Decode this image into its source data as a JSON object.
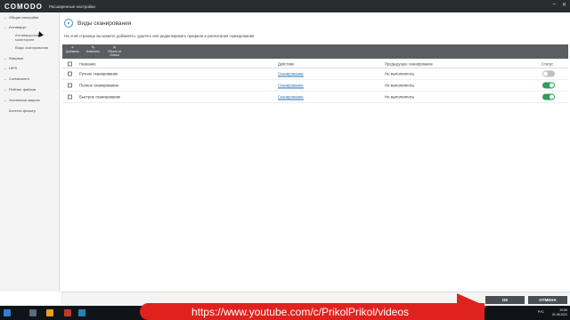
{
  "titlebar": {
    "brand": "COMODO",
    "title": "Расширенные настройки"
  },
  "sidebar": {
    "items": [
      {
        "label": "Общие настройки"
      },
      {
        "label": "Антивирус"
      },
      {
        "label": "Фаервол"
      },
      {
        "label": "HIPS"
      },
      {
        "label": "Containment"
      },
      {
        "label": "Рейтинг файлов"
      },
      {
        "label": "Усиленная защита"
      },
      {
        "label": "Контент-фильтр"
      }
    ],
    "sub": [
      {
        "label": "Антивирусный мониторинг"
      },
      {
        "label": "Виды сканирования"
      }
    ]
  },
  "header": {
    "title": "Виды сканирования",
    "description": "На этой странице вы можете добавлять, удалять или редактировать профили и расписания сканирования"
  },
  "toolbar": {
    "buttons": [
      {
        "label": "Добавить",
        "icon": "plus-icon"
      },
      {
        "label": "Изменить",
        "icon": "pencil-icon"
      },
      {
        "label": "Убрать из списка",
        "icon": "cross-icon"
      }
    ]
  },
  "table": {
    "columns": [
      "Название",
      "Действие",
      "Предыдущее сканирование",
      "Статус"
    ],
    "rows": [
      {
        "name": "Ручное сканирование",
        "action": "Сканирование",
        "previous": "Не выполнялось",
        "status_on": false
      },
      {
        "name": "Полное сканирование",
        "action": "Сканирование",
        "previous": "Не выполнялось",
        "status_on": true
      },
      {
        "name": "Быстрое сканирование",
        "action": "Сканирование",
        "previous": "Не выполнялось",
        "status_on": true
      }
    ]
  },
  "footer": {
    "ok": "ОК",
    "cancel": "ОТМЕНА"
  },
  "taskbar": {
    "lang": "РУС",
    "time": "20:55",
    "date": "01.08.2022"
  },
  "banner": {
    "text": "https://www.youtube.com/c/PrikolPrikol/videos"
  },
  "colors": {
    "accent": "#4a90c2",
    "toggle_on": "#2e9e5b",
    "toggle_off": "#bfbfbf",
    "banner": "#e0221e",
    "toolbar": "#5a5e63"
  }
}
